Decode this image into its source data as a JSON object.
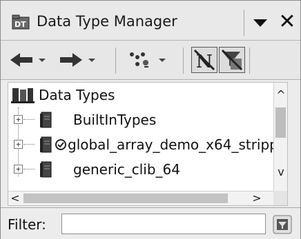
{
  "window": {
    "title": "Data Type Manager",
    "close_glyph": "✕"
  },
  "toolbar": {
    "back": "arrow-left-icon",
    "back_menu": "dropdown-arrow-icon",
    "forward": "arrow-right-icon",
    "forward_menu": "dropdown-arrow-icon",
    "action": "cluster-dots-icon",
    "action_menu": "dropdown-arrow-icon",
    "toggle_1": "no-sync-toggle-icon",
    "toggle_2": "filter-toggle-icon"
  },
  "tree": {
    "root": {
      "label": "Data Types",
      "icon": "books-icon"
    },
    "items": [
      {
        "label": "BuiltInTypes",
        "icon": "archive-icon",
        "expander": "+"
      },
      {
        "label": "global_array_demo_x64_stripp",
        "icon": "archive-icon",
        "badge": "check-badge-icon",
        "expander": "+"
      },
      {
        "label": "generic_clib_64",
        "icon": "archive-icon",
        "expander": "+"
      }
    ]
  },
  "scroll": {
    "up": "^",
    "down": "v",
    "left": "<",
    "right": ">"
  },
  "filter": {
    "label": "Filter:",
    "value": ""
  },
  "colors": {
    "panel_bg": "#ececec",
    "tree_bg": "#ffffff",
    "border": "#8a8a8a",
    "scroll_thumb": "#c2c2c2"
  }
}
